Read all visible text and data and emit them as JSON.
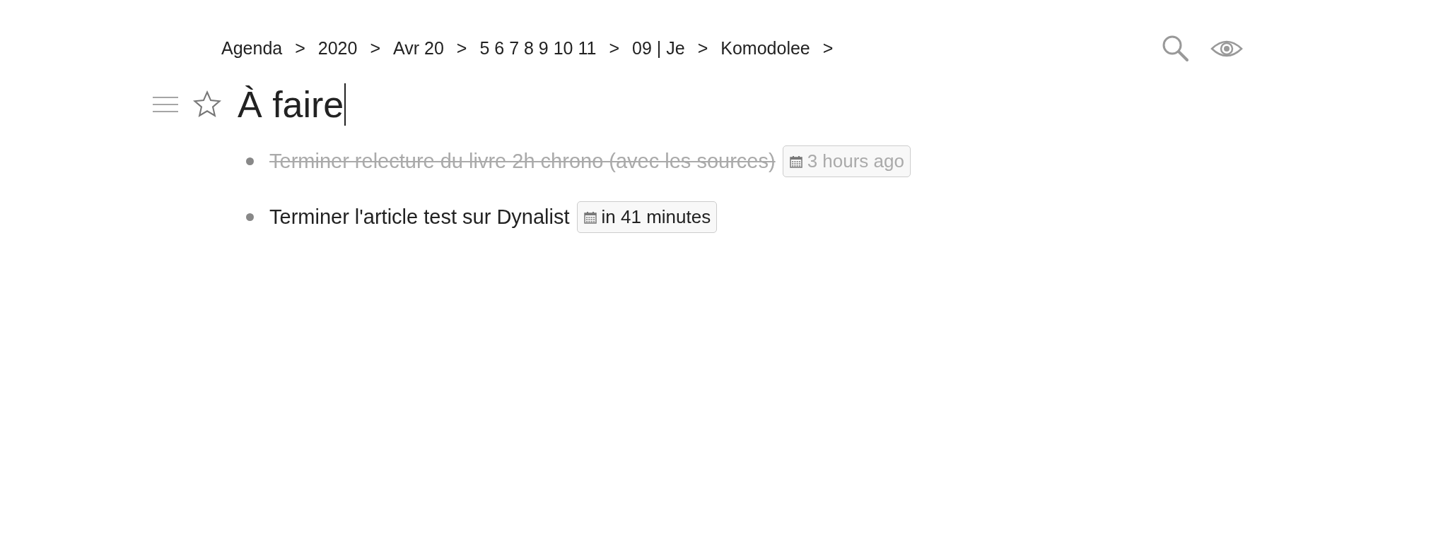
{
  "breadcrumb": [
    "Agenda",
    "2020",
    "Avr 20",
    "5 6 7 8 9 10 11",
    "09 | Je",
    "Komodolee"
  ],
  "breadcrumb_separator": ">",
  "title": "À faire",
  "starred": false,
  "items": [
    {
      "text": "Terminer relecture du livre 2h chrono (avec les sources)",
      "date": "3 hours ago",
      "completed": true
    },
    {
      "text": "Terminer l'article test sur Dynalist",
      "date": "in 41 minutes",
      "completed": false
    }
  ]
}
